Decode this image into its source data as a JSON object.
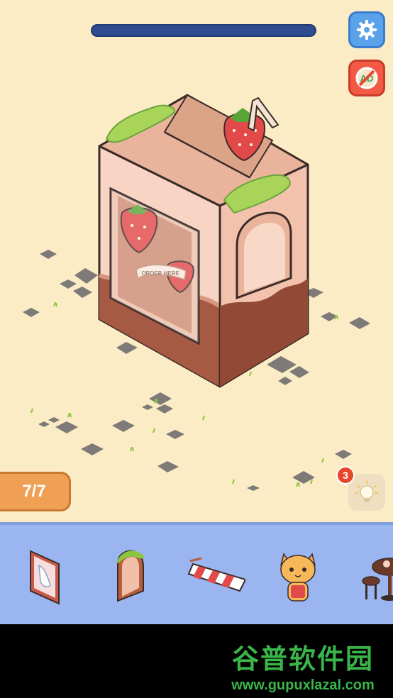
{
  "hud": {
    "level_progress_label": "7/7",
    "progress_fraction": 0.0,
    "hint_count": "3",
    "settings_icon": "gear-icon",
    "no_ads_icon": "no-ads-icon",
    "hint_icon": "lightbulb-icon"
  },
  "scene": {
    "box_sign_text": "ORDER HERE",
    "colors": {
      "background": "#fcecc6",
      "box_light": "#f7d4c4",
      "box_dark": "#a65a43",
      "strawberry": "#e24a4a"
    }
  },
  "tray": {
    "items": [
      {
        "name": "wall-poster-item"
      },
      {
        "name": "arched-door-item"
      },
      {
        "name": "striped-awning-item"
      },
      {
        "name": "cat-cashier-item"
      },
      {
        "name": "cafe-table-item"
      }
    ]
  },
  "watermark": {
    "title": "谷普软件园",
    "url": "www.gupuxlazal.com"
  }
}
